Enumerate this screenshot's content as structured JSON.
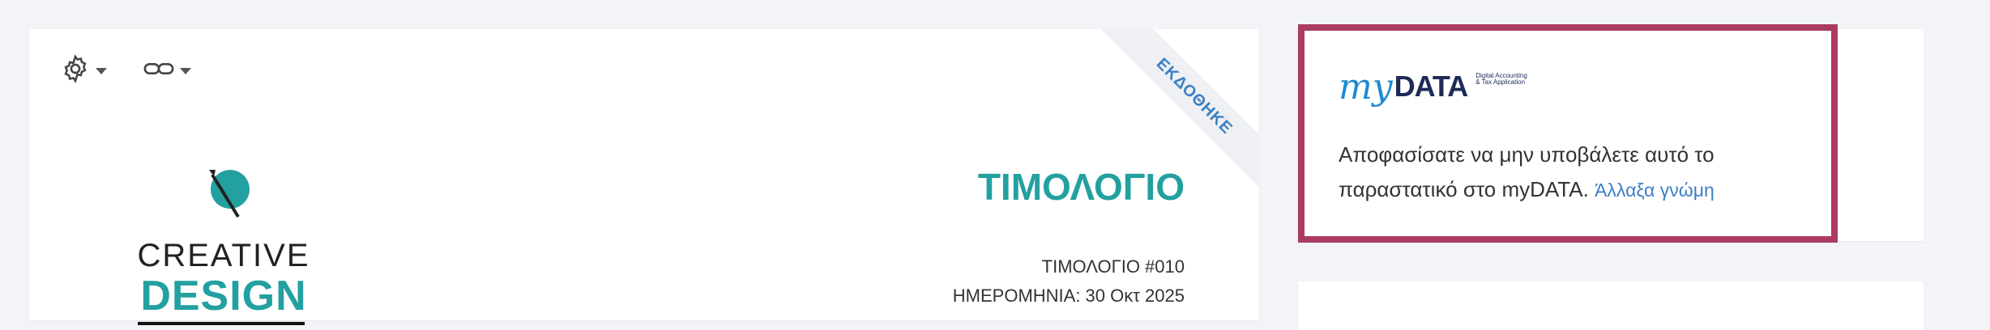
{
  "toolbar": {
    "settings_icon": "gear-icon",
    "link_icon": "link-icon"
  },
  "invoice": {
    "status_ribbon": "ΕΚΔΟΘΗΚΕ",
    "title": "ΤΙΜΟΛΟΓΙΟ",
    "number": "ΤΙΜΟΛΟΓΙΟ #010",
    "date": "ΗΜΕΡΟΜΗΝΙΑ: 30 Οκτ 2025",
    "accent_color": "#23a0a0"
  },
  "logo": {
    "line1": "CREATIVE",
    "line2": "DESIGN"
  },
  "mydata": {
    "brand_my": "my",
    "brand_data": "DATA",
    "brand_sub": "Digital Accounting & Tax Application",
    "message": "Αποφασίσατε να μην υποβάλετε αυτό το παραστατικό στο myDATA.",
    "change_link": "Άλλαξα γνώμη",
    "highlight_color": "#ab3b63"
  }
}
